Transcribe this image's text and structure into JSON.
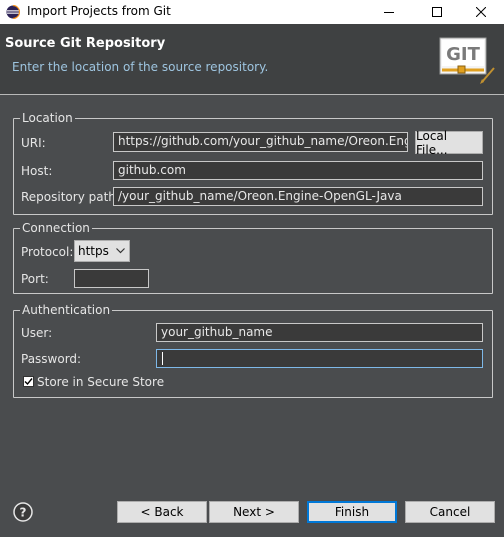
{
  "window": {
    "title": "Import Projects from Git",
    "app_icon": "eclipse-icon"
  },
  "header": {
    "title": "Source Git Repository",
    "subtitle": "Enter the location of the source repository.",
    "logo_text": "GIT"
  },
  "location": {
    "legend": "Location",
    "uri_label": "URI:",
    "uri_value": "https://github.com/your_github_name/Oreon.Engine-",
    "local_file_button": "Local File...",
    "host_label": "Host:",
    "host_value": "github.com",
    "repo_path_label": "Repository path:",
    "repo_path_value": "/your_github_name/Oreon.Engine-OpenGL-Java"
  },
  "connection": {
    "legend": "Connection",
    "protocol_label": "Protocol:",
    "protocol_value": "https",
    "port_label": "Port:",
    "port_value": ""
  },
  "authentication": {
    "legend": "Authentication",
    "user_label": "User:",
    "user_value": "your_github_name",
    "password_label": "Password:",
    "password_value": "",
    "store_label": "Store in Secure Store",
    "store_checked": true
  },
  "footer": {
    "back_label": "< Back",
    "next_label": "Next >",
    "finish_label": "Finish",
    "cancel_label": "Cancel"
  }
}
